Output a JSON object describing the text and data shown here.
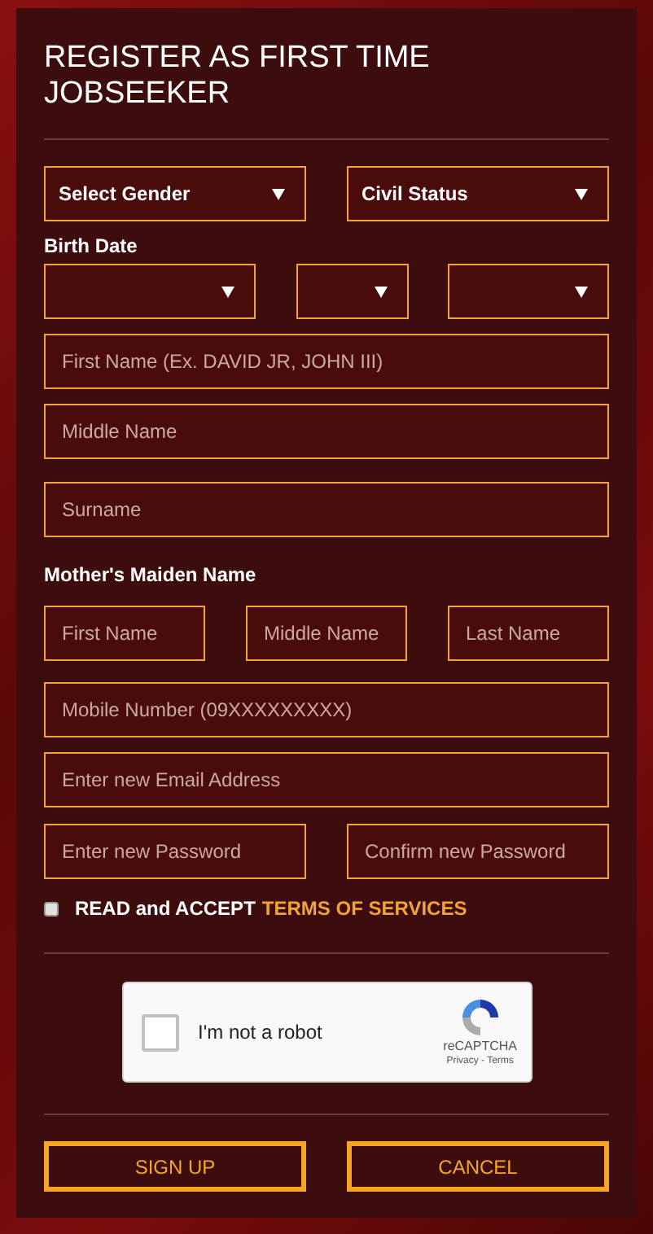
{
  "title": "REGISTER AS FIRST TIME JOBSEEKER",
  "selects": [
    {
      "value": "Select Gender"
    },
    {
      "value": "Civil Status"
    }
  ],
  "birth_date_label": "Birth Date",
  "name_fields": [
    {
      "placeholder": "First Name (Ex. DAVID JR, JOHN III)"
    },
    {
      "placeholder": "Middle Name"
    },
    {
      "placeholder": "Surname"
    }
  ],
  "mother_label": "Mother's Maiden Name",
  "mother_fields": [
    {
      "placeholder": "First Name"
    },
    {
      "placeholder": "Middle Name"
    },
    {
      "placeholder": "Last Name"
    }
  ],
  "contact_fields": [
    {
      "placeholder": "Mobile Number (09XXXXXXXXX)"
    },
    {
      "placeholder": "Enter new Email Address"
    }
  ],
  "password_fields": [
    {
      "placeholder": "Enter new Password"
    },
    {
      "placeholder": "Confirm new Password"
    }
  ],
  "terms": {
    "checked": false,
    "text": "READ and ACCEPT",
    "link": "TERMS OF SERVICES"
  },
  "captcha": {
    "checked": false,
    "label": "I'm not a robot",
    "brand": "reCAPTCHA",
    "links": "Privacy - Terms"
  },
  "buttons": [
    "SIGN UP",
    "CANCEL"
  ]
}
